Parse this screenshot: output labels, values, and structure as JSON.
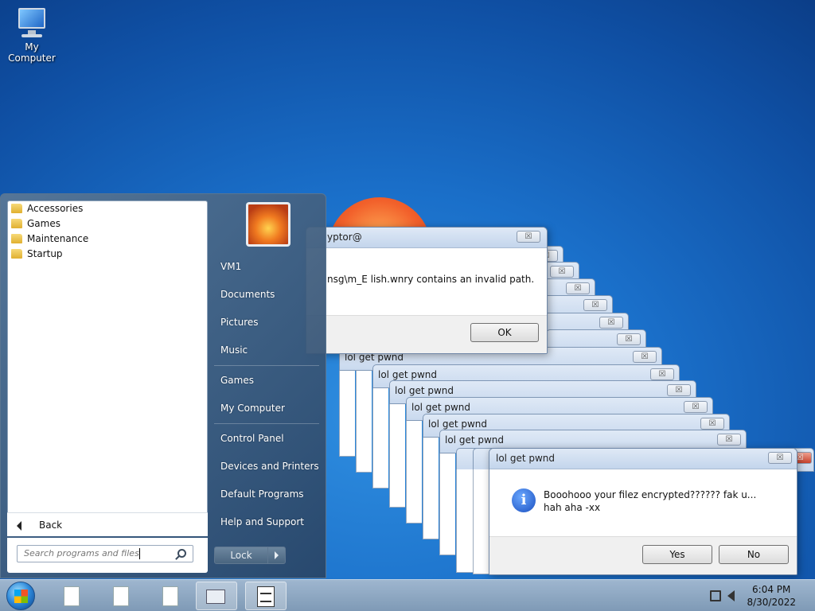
{
  "desktop": {
    "icon_label": "My Computer"
  },
  "error_dialog": {
    "title": "yptor@",
    "message": "nsg\\m_E  lish.wnry contains an invalid path.",
    "ok": "OK",
    "close": "☒"
  },
  "stack_title": "lol get pwnd",
  "main_dialog": {
    "title": "lol get pwnd",
    "message": "Booohooo your filez encrypted?????? fak u... hah aha -xx",
    "yes": "Yes",
    "no": "No",
    "close": "☒"
  },
  "start_menu": {
    "folders": [
      "Accessories",
      "Games",
      "Maintenance",
      "Startup"
    ],
    "back": "Back",
    "search_placeholder": "Search programs and files",
    "user": "VM1",
    "right": [
      "Documents",
      "Pictures",
      "Music",
      "Games",
      "My Computer",
      "Control Panel",
      "Devices and Printers",
      "Default Programs",
      "Help and Support"
    ],
    "lock": "Lock"
  },
  "tray": {
    "time": "6:04 PM",
    "date": "8/30/2022"
  }
}
